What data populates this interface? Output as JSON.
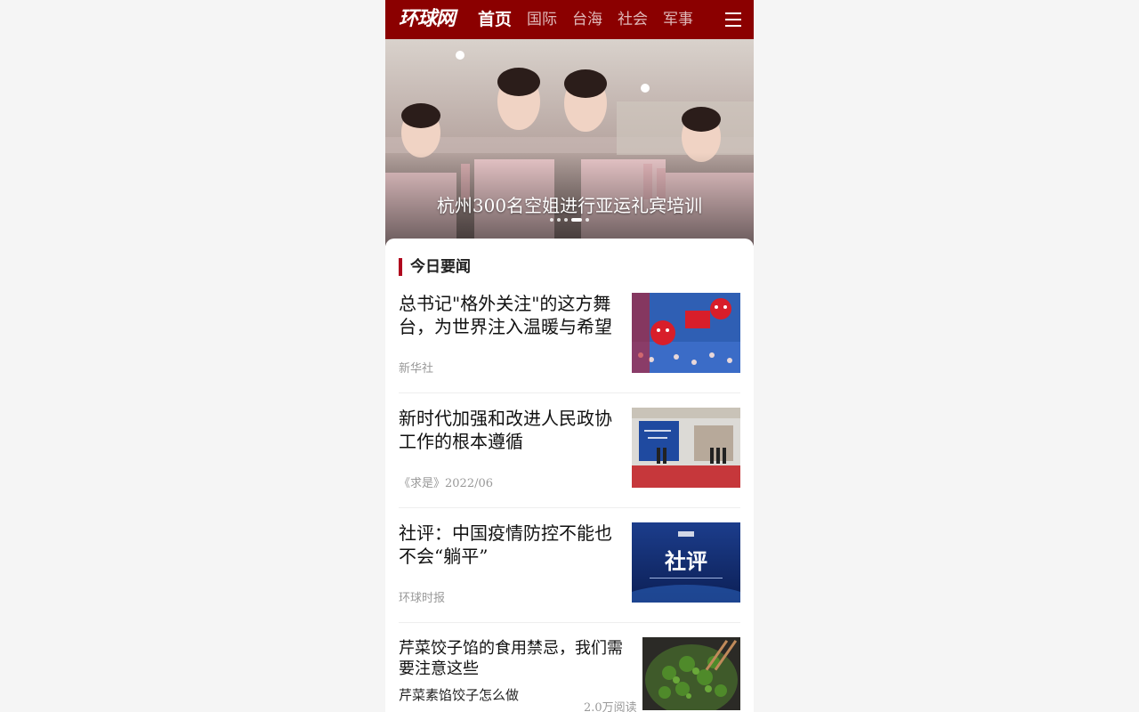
{
  "header": {
    "logo": "环球网",
    "nav": [
      "首页",
      "国际",
      "台海",
      "社会",
      "军事"
    ],
    "active_nav": "首页",
    "menu_icon": "menu-icon",
    "brand_color": "#8b0000"
  },
  "banner": {
    "caption": "杭州300名空姐进行亚运礼宾培训",
    "slide_count": 5,
    "active_slide": 4
  },
  "section": {
    "title": "今日要闻",
    "accent_color": "#b0071e"
  },
  "news": [
    {
      "title": "总书记\"格外关注\"的这方舞台，为世界注入温暖与希望",
      "source": "新华社"
    },
    {
      "title": "新时代加强和改进人民政协工作的根本遵循",
      "source": "《求是》2022/06"
    },
    {
      "title": "社评：中国疫情防控不能也不会“躺平”",
      "source": "环球时报",
      "thumb_text": "社评"
    },
    {
      "title": "芹菜饺子馅的食用禁忌，我们需要注意这些",
      "subtitle": "芹菜素馅饺子怎么做",
      "reads": "2.0万阅读"
    }
  ]
}
